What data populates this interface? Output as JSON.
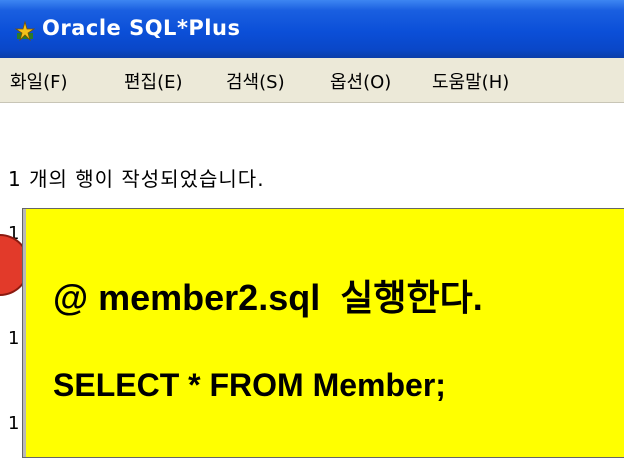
{
  "window": {
    "title": "Oracle SQL*Plus",
    "icon": "sqlplus-app-icon"
  },
  "menubar": {
    "items": [
      "화일(F)",
      "편집(E)",
      "검색(S)",
      "옵션(O)",
      "도움말(H)"
    ]
  },
  "console": {
    "line1": "1 개의 행이 작성되었습니다.",
    "markers": [
      "1",
      "1",
      "1"
    ]
  },
  "callout": {
    "line1": "@ member2.sql  실행한다.",
    "line2": "SELECT * FROM Member;"
  },
  "colors": {
    "titlebar": "#0b4fd8",
    "menubar": "#ece9d8",
    "callout": "#ffff00",
    "badge": "#e23a2a"
  }
}
